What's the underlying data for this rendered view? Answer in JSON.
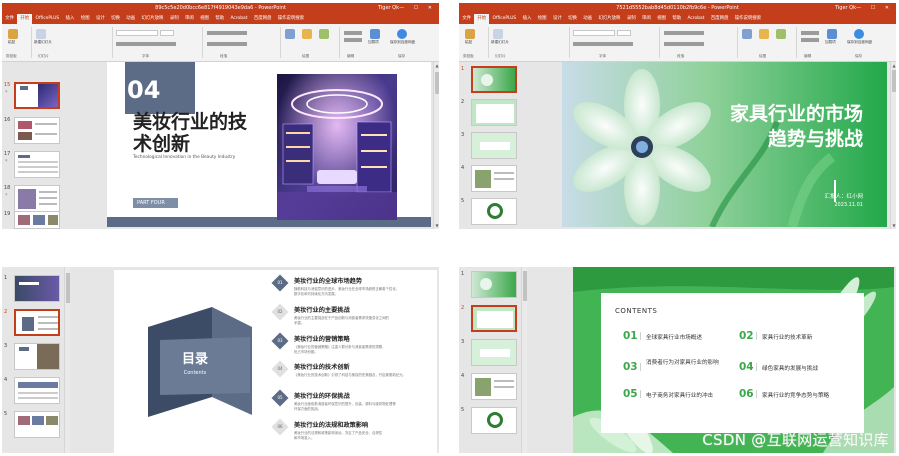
{
  "app_window": {
    "ribbon_tabs": [
      "文件",
      "开始",
      "OfficePLUS",
      "插入",
      "绘图",
      "设计",
      "切换",
      "动画",
      "幻灯片放映",
      "录制",
      "审阅",
      "视图",
      "帮助",
      "Acrobat",
      "百度网盘",
      "操作说明搜索"
    ],
    "active_tab": "开始",
    "ribbon_labels": {
      "paste": "粘贴",
      "clipboard": "剪贴板",
      "new_slide": "新建幻灯片",
      "slides": "幻灯片",
      "font": "字体",
      "paragraph": "段落",
      "drawing": "绘图",
      "edit": "编辑",
      "accessibility": "加载项",
      "save_baidu": "保存到百度网盘",
      "baidu_group": "保存"
    },
    "user": "Tiger Qk",
    "window_controls": "— ☐ ✕"
  },
  "windows": [
    {
      "doc_title": "89c5c5e20d0bcc6e817f4919043e9da6 - PowerPoint",
      "thumbnails": [
        {
          "num": "15",
          "selected": true,
          "star": "*"
        },
        {
          "num": "16",
          "selected": false,
          "star": ""
        },
        {
          "num": "17",
          "selected": false,
          "star": "*"
        },
        {
          "num": "18",
          "selected": false,
          "star": "*"
        },
        {
          "num": "19",
          "selected": false,
          "star": ""
        }
      ],
      "slide": {
        "number": "04",
        "title": "美妆行业的技术创新",
        "subtitle": "Technological Innovation in the Beauty Industry",
        "part": "PART FOUR"
      }
    },
    {
      "doc_title": "7521d5552bab8d45d0110b2fb9c6e - PowerPoint",
      "thumbnails": [
        {
          "num": "1",
          "selected": true,
          "star": ""
        },
        {
          "num": "2",
          "selected": false,
          "star": ""
        },
        {
          "num": "3",
          "selected": false,
          "star": ""
        },
        {
          "num": "4",
          "selected": false,
          "star": ""
        },
        {
          "num": "5",
          "selected": false,
          "star": ""
        }
      ],
      "slide": {
        "title_line1": "家具行业的市场",
        "title_line2": "趋势与挑战",
        "reporter": "汇报人：红小网",
        "date": "2023.11.01"
      }
    },
    {
      "thumbnails": [
        {
          "num": "1",
          "selected": false,
          "star": ""
        },
        {
          "num": "2",
          "selected": true,
          "star": ""
        },
        {
          "num": "3",
          "selected": false,
          "star": ""
        },
        {
          "num": "4",
          "selected": false,
          "star": ""
        },
        {
          "num": "5",
          "selected": false,
          "star": ""
        }
      ],
      "slide": {
        "title": "目录",
        "subtitle": "Contents",
        "items": [
          {
            "num": "01",
            "title": "美妆行业的全球市场趋势",
            "d1": "随着科技与消费意识的进步，美妆行业在全球市场趋势正朝着个性化、",
            "d2": "数字化和可持续化方向发展。"
          },
          {
            "num": "02",
            "title": "美妆行业的主要挑战",
            "d1": "美妆行业的主要挑战在于产品创新与消费者需求快速变化之间的",
            "d2": "矛盾。"
          },
          {
            "num": "03",
            "title": "美妆行业的营销策略",
            "d1": "《美妆行业的营销策略》注重人群分析与消费者需求的洞察，",
            "d2": "抢占市场份额。"
          },
          {
            "num": "04",
            "title": "美妆行业的技术创新",
            "d1": "《美妆行业的技术创新》引领了科技与美容的完美融合，开启美丽新纪元。",
            "d2": ""
          },
          {
            "num": "05",
            "title": "美妆行业的环保挑战",
            "d1": "美妆行业面临着消费者环保意识的提升，包装、原料与废弃物处理等",
            "d2": "环保方面的挑战。"
          },
          {
            "num": "06",
            "title": "美妆行业的法规和政策影响",
            "d1": "美妆行业的法规和政策影响深远，决定了产品安全、合规性",
            "d2": "和市场准入。"
          }
        ]
      }
    },
    {
      "thumbnails": [
        {
          "num": "1",
          "selected": false,
          "star": ""
        },
        {
          "num": "2",
          "selected": true,
          "star": ""
        },
        {
          "num": "3",
          "selected": false,
          "star": ""
        },
        {
          "num": "4",
          "selected": false,
          "star": ""
        },
        {
          "num": "5",
          "selected": false,
          "star": ""
        }
      ],
      "slide": {
        "title": "CONTENTS",
        "items": [
          {
            "num": "01",
            "text": "全球家具行业市场概述"
          },
          {
            "num": "02",
            "text": "家具行业的技术革新"
          },
          {
            "num": "03",
            "text": "消费者行为对家具行业的影响"
          },
          {
            "num": "04",
            "text": "绿色家具的发展与挑战"
          },
          {
            "num": "05",
            "text": "电子商务对家具行业的冲击"
          },
          {
            "num": "06",
            "text": "家具行业的竞争态势与策略"
          }
        ]
      }
    }
  ],
  "watermark": "CSDN @互联网运营知识库",
  "colors": {
    "ppt_red": "#c43e1c",
    "slate": "#5c6c86",
    "green": "#3aa84a"
  }
}
